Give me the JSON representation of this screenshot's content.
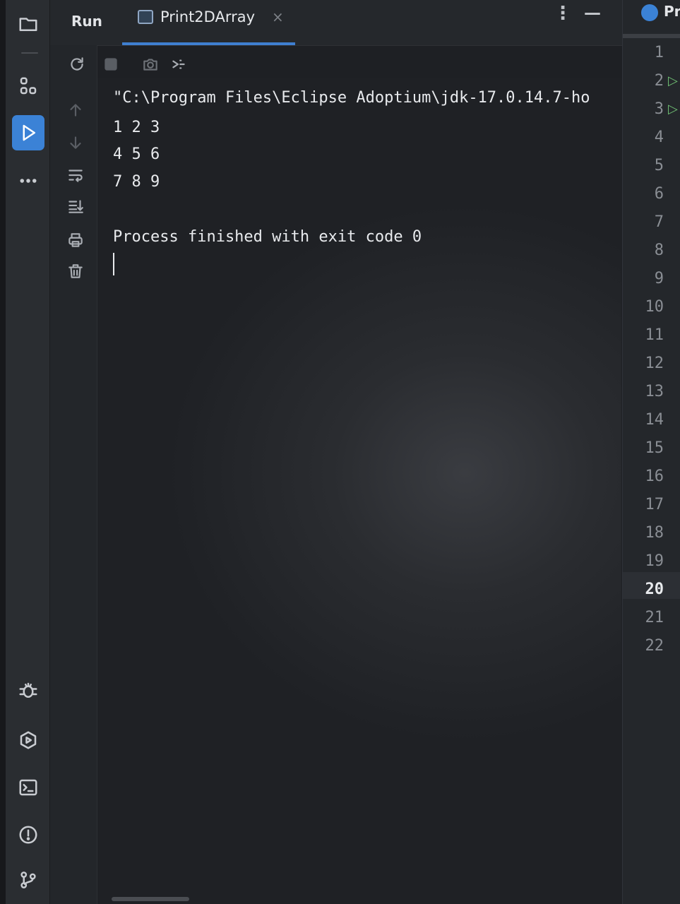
{
  "top_bar": {
    "run_label": "Run",
    "tab_label": "Print2DArray",
    "close_glyph": "×",
    "more_glyph": "⋮",
    "minimize_glyph": "—"
  },
  "right_gutter": {
    "editor_tab_label": "Pr",
    "line_numbers": [
      "1",
      "2",
      "3",
      "4",
      "5",
      "6",
      "7",
      "8",
      "9",
      "10",
      "11",
      "12",
      "13",
      "14",
      "15",
      "16",
      "17",
      "18",
      "19",
      "20",
      "21",
      "22"
    ],
    "current_line": "20"
  },
  "console": {
    "lines": [
      "\"C:\\Program Files\\Eclipse Adoptium\\jdk-17.0.14.7-ho",
      "1 2 3",
      "4 5 6",
      "7 8 9",
      "",
      "Process finished with exit code 0"
    ]
  },
  "icons": {
    "left_bar_top": [
      "folder-icon",
      "structure-icon",
      "run-icon",
      "more-icon"
    ],
    "left_bar_bottom": [
      "debug-icon",
      "services-icon",
      "terminal-icon",
      "problems-icon",
      "git-icon"
    ],
    "tool_column": [
      "up-arrow-icon",
      "down-arrow-icon",
      "soft-wrap-icon",
      "scroll-to-end-icon",
      "print-icon",
      "trash-icon"
    ],
    "tool_row": [
      "rerun-icon",
      "stop-icon",
      "camera-icon",
      "pin-icon"
    ]
  },
  "colors": {
    "accent": "#3b82d6",
    "background": "#1e2024",
    "text": "#e8eaed"
  }
}
